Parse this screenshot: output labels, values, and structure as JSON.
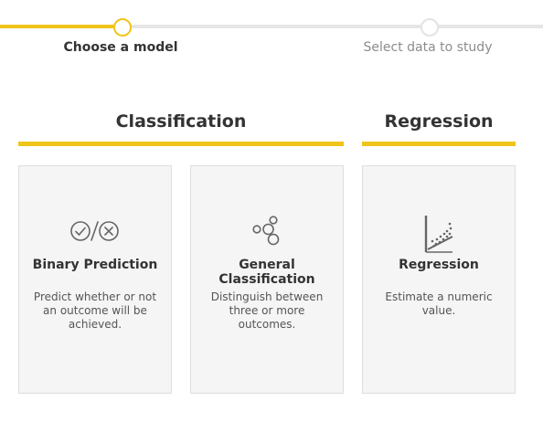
{
  "stepper": {
    "steps": [
      {
        "label": "Choose a model",
        "state": "active"
      },
      {
        "label": "Select data to study",
        "state": "inactive"
      }
    ],
    "accent_color": "#f0c419",
    "inactive_color": "#e6e6e6"
  },
  "sections": [
    {
      "title": "Classification"
    },
    {
      "title": "Regression"
    }
  ],
  "cards": [
    {
      "icon": "binary-check-x-icon",
      "title": "Binary Prediction",
      "description": "Predict whether or not an outcome will be achieved."
    },
    {
      "icon": "clusters-icon",
      "title": "General Classification",
      "description": "Distinguish between three or more outcomes."
    },
    {
      "icon": "scatter-trend-icon",
      "title": "Regression",
      "description": "Estimate a numeric value."
    }
  ]
}
